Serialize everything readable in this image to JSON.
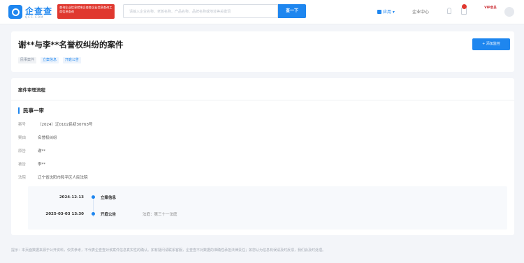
{
  "topbar": {
    "logo_text": "企查查",
    "logo_sub": "QCC.COM",
    "promo_text": "查询企业信息就来企查查企业信息查询工商信息查询",
    "search_placeholder": "请输入企业名称、老板名称、产品名称、品牌名称或地址等关键词",
    "search_button": "查一下",
    "app_label": "应用",
    "center_label": "企业中心",
    "vip_label": "VIP会员"
  },
  "header": {
    "title": "谢**与李**名誉权纠纷的案件",
    "tags": [
      "民事案件",
      "立案信息",
      "开庭公告"
    ],
    "follow_button": "+ 添加监控"
  },
  "main": {
    "section_title": "案件审理流程",
    "stage_title": "民事一审",
    "fields": [
      {
        "key": "案号",
        "value": "（2024）辽0102民初30763号"
      },
      {
        "key": "案由",
        "value": "名誉权纠纷"
      },
      {
        "key": "原告",
        "value": "谢**"
      },
      {
        "key": "被告",
        "value": "李**"
      },
      {
        "key": "法院",
        "value": "辽宁省沈阳市和平区人民法院"
      }
    ],
    "timeline": [
      {
        "date": "2024-12-13",
        "event": "立案信息",
        "note": ""
      },
      {
        "date": "2025-03-03 13:30",
        "event": "开庭公告",
        "note": "法庭：第三十一法庭"
      }
    ]
  },
  "footer": {
    "text": "提示：本页面数据来源于公开资料，仅供参考，不代表企查查对该案件信息真实性的确认。如有疑问请联系客服，企查查不对数据的准确性承担法律责任；如您认为信息有误请及时反馈，我们会及时处理。"
  }
}
